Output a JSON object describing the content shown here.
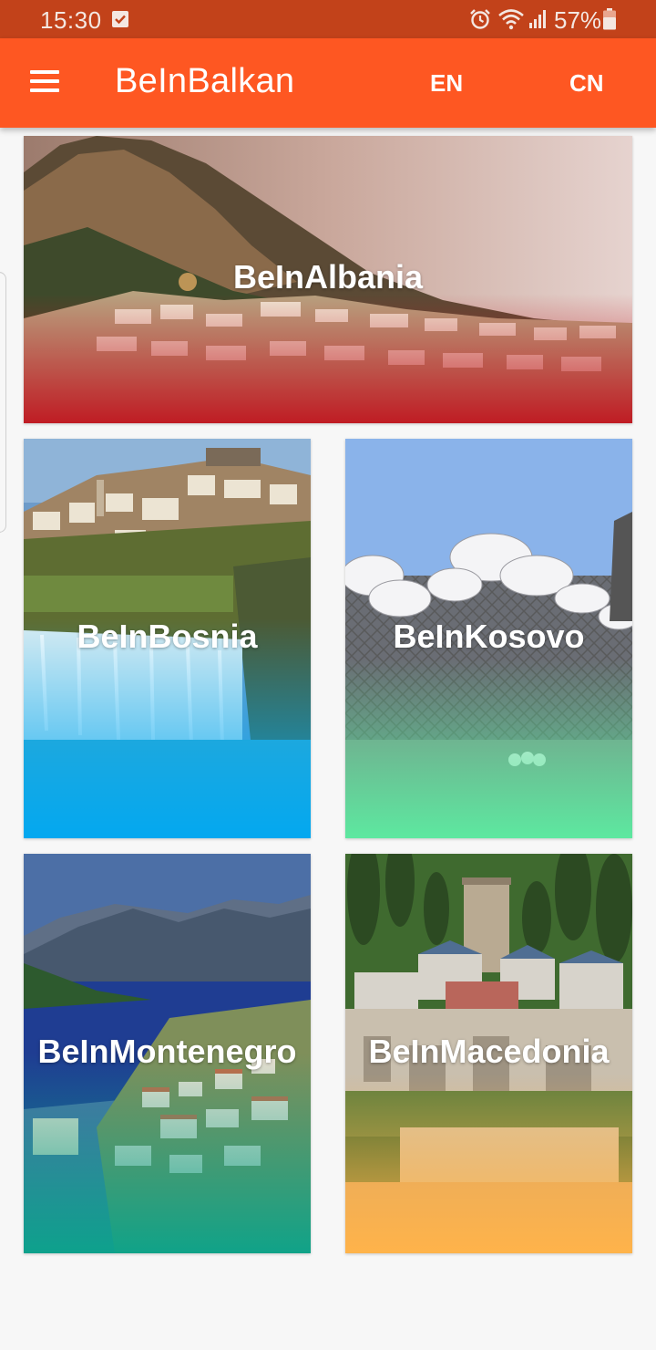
{
  "status_bar": {
    "time": "15:30",
    "battery": "57%",
    "icons": [
      "checkbox-icon",
      "alarm-icon",
      "wifi-icon",
      "signal-icon",
      "battery-icon"
    ]
  },
  "app_bar": {
    "title": "BeInBalkan",
    "menu_icon": "menu-icon",
    "languages": [
      "EN",
      "CN"
    ],
    "color": "#fe5722"
  },
  "cards": [
    {
      "label": "BeInAlbania",
      "overlay_color": "#c0151f"
    },
    {
      "label": "BeInBosnia",
      "overlay_color": "#00a8f2"
    },
    {
      "label": "BeInKosovo",
      "overlay_color": "#5de8a0"
    },
    {
      "label": "BeInMontenegro",
      "overlay_color": "#0aa48b"
    },
    {
      "label": "BeInMacedonia",
      "overlay_color": "#ffb34a"
    }
  ]
}
